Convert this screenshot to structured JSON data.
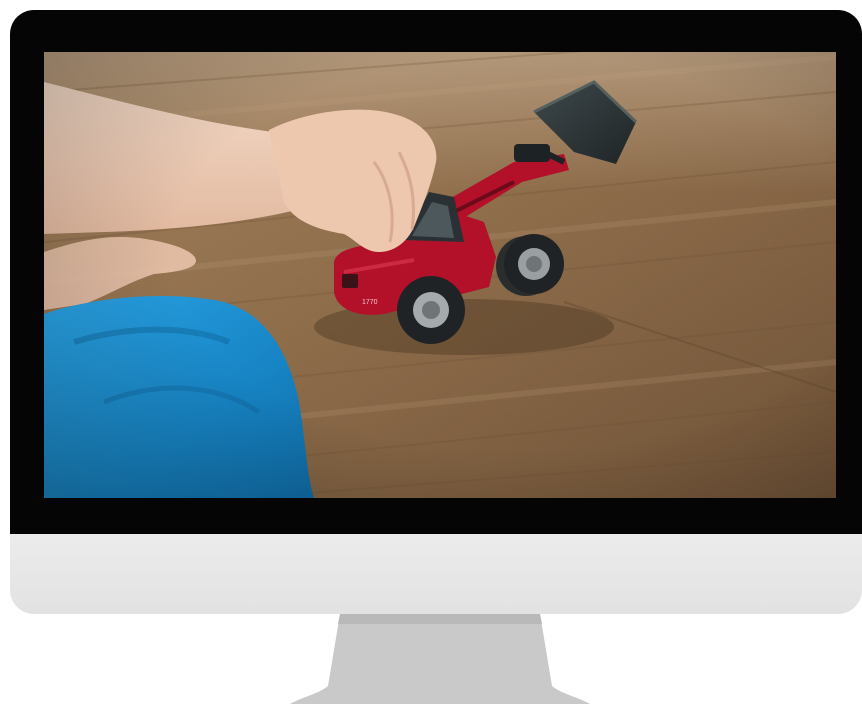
{
  "device": {
    "type": "desktop-monitor",
    "bezel_color": "#050505",
    "chin_color": "#e6e6e6",
    "stand_color": "#c9c9c9"
  },
  "screen": {
    "content": "photograph",
    "toy_body_color": "#b3102a",
    "bucket_color": "#2c3336",
    "floor_color": "#8a6a48",
    "sleeve_color": "#1b8fd0",
    "toy_marking": "1770"
  }
}
